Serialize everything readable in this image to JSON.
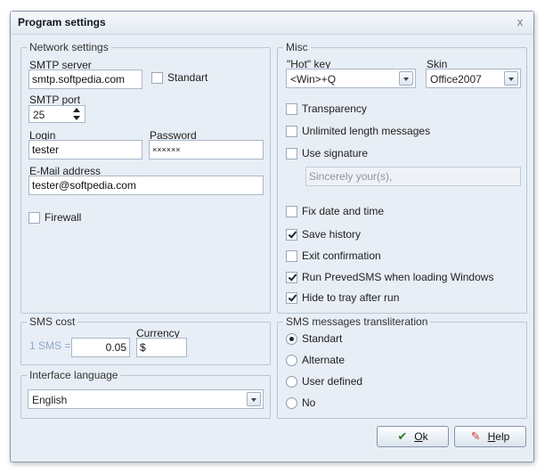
{
  "window": {
    "title": "Program settings",
    "close_glyph": "x"
  },
  "network": {
    "legend": "Network settings",
    "smtp_server_label": "SMTP server",
    "smtp_server_value": "smtp.softpedia.com",
    "standart_label": "Standart",
    "smtp_port_label": "SMTP port",
    "smtp_port_value": "25",
    "login_label": "Login",
    "login_value": "tester",
    "password_label": "Password",
    "password_value": "××××××",
    "email_label": "E-Mail address",
    "email_value": "tester@softpedia.com",
    "firewall_label": "Firewall"
  },
  "misc": {
    "legend": "Misc",
    "hotkey_label": "\"Hot\" key",
    "hotkey_value": "<Win>+Q",
    "skin_label": "Skin",
    "skin_value": "Office2007",
    "transparency_label": "Transparency",
    "unlimited_label": "Unlimited length messages",
    "use_signature_label": "Use signature",
    "signature_value": "Sincerely your(s),",
    "fix_date_label": "Fix date and time",
    "save_history_label": "Save history",
    "exit_confirm_label": "Exit confirmation",
    "run_label": "Run PrevedSMS when loading Windows",
    "hide_tray_label": "Hide to tray after run"
  },
  "sms_cost": {
    "legend": "SMS cost",
    "one_sms_label": "1 SMS =",
    "cost_value": "0.05",
    "currency_label": "Currency",
    "currency_value": "$"
  },
  "language": {
    "legend": "Interface language",
    "value": "English"
  },
  "translit": {
    "legend": "SMS messages transliteration",
    "options": [
      "Standart",
      "Alternate",
      "User defined",
      "No"
    ]
  },
  "buttons": {
    "ok_label": "Ok",
    "help_label": "Help"
  },
  "colors": {
    "dialog_bg": "#e8eef5",
    "group_border": "#b9c6d6"
  }
}
